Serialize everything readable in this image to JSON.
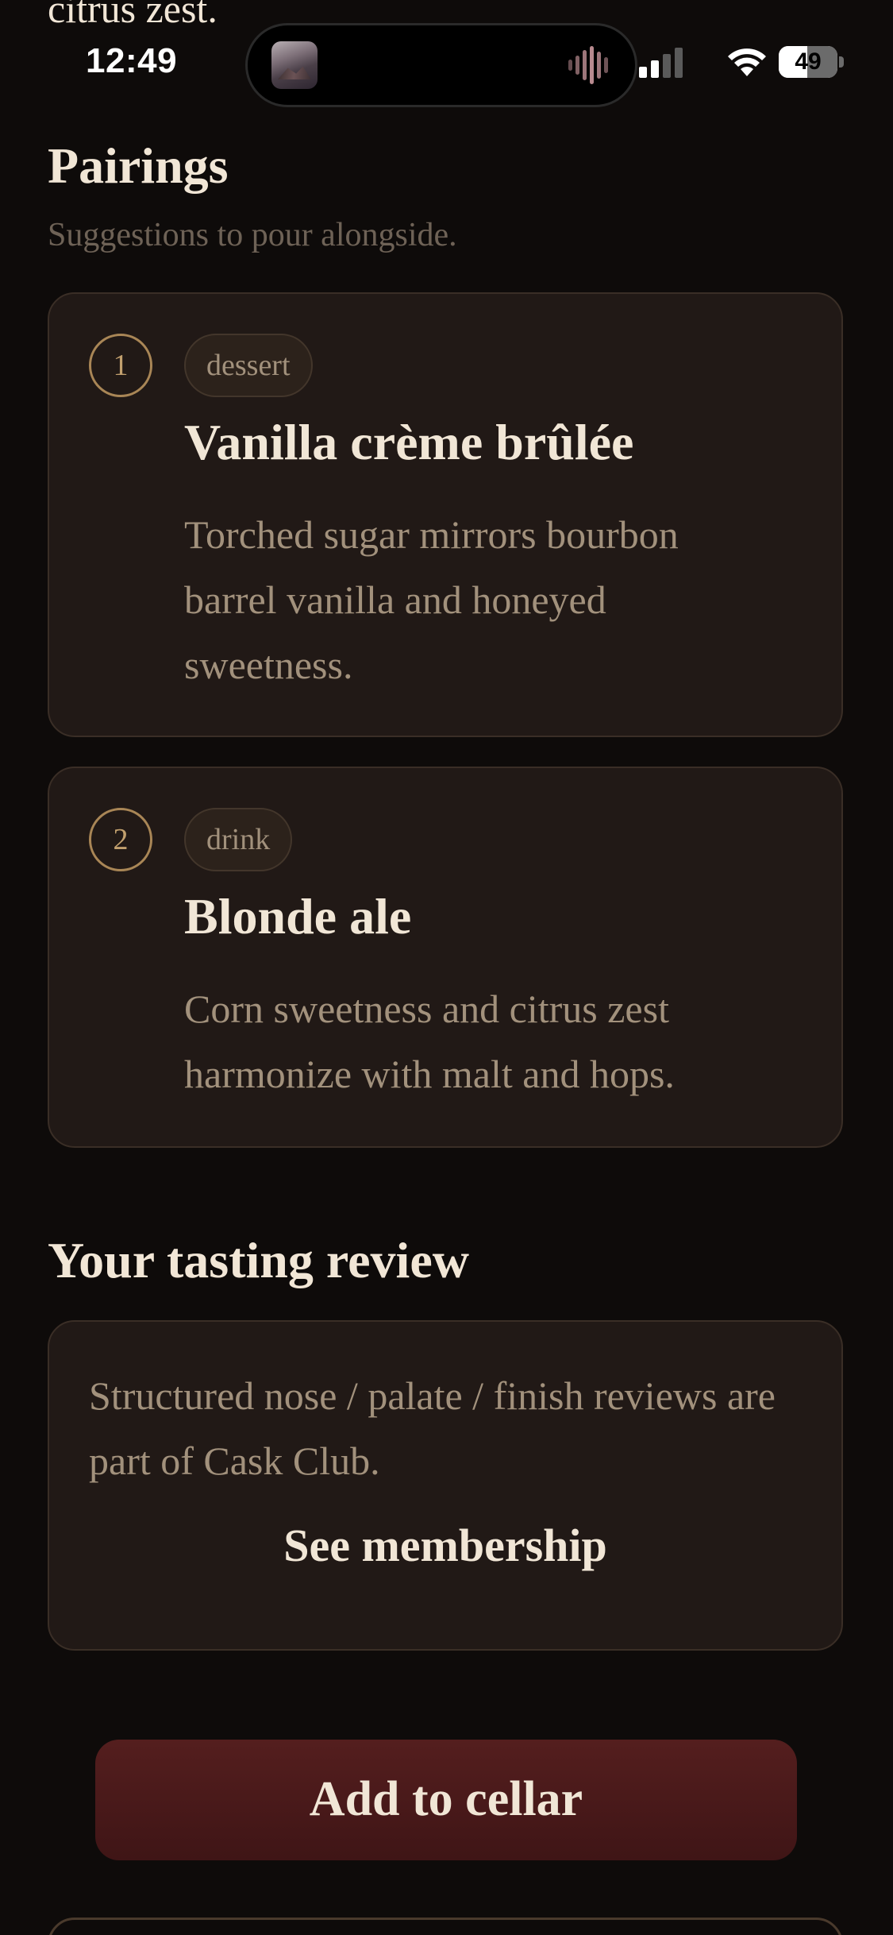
{
  "previous_section": {
    "tail_text": "citrus zest."
  },
  "status_bar": {
    "time": "12:49",
    "battery_level": "49",
    "battery_fraction": 0.49,
    "signal_bars_active": 2,
    "signal_bars_total": 4,
    "icons": [
      "album-art-icon",
      "audio-wave-icon",
      "cellular-signal-icon",
      "wifi-icon",
      "battery-icon"
    ]
  },
  "pairings": {
    "title": "Pairings",
    "subtitle": "Suggestions to pour alongside.",
    "items": [
      {
        "number": "1",
        "tag": "dessert",
        "title": "Vanilla crème brûlée",
        "description": "Torched sugar mirrors bourbon barrel vanilla and honeyed sweetness."
      },
      {
        "number": "2",
        "tag": "drink",
        "title": "Blonde ale",
        "description": "Corn sweetness and citrus zest harmonize with malt and hops."
      }
    ]
  },
  "review": {
    "title": "Your tasting review",
    "locked_message": "Structured nose / palate / finish reviews are part of Cask Club.",
    "link_label": "See membership"
  },
  "actions": {
    "add_to_cellar": "Add to cellar"
  },
  "colors": {
    "background": "#0e0b0a",
    "card": "#211916",
    "card_border": "#3a2e26",
    "accent_gold": "#a98656",
    "text_primary": "#f1e6d6",
    "text_muted": "#a2917c",
    "button_wine": "#4a1a1b"
  }
}
